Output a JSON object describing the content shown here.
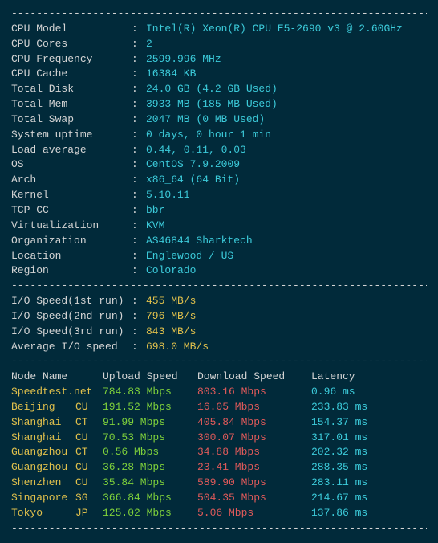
{
  "dash": "----------------------------------------------------------------------",
  "sys": [
    {
      "label": "CPU Model",
      "value": "Intel(R) Xeon(R) CPU E5-2690 v3 @ 2.60GHz",
      "class": "cyan"
    },
    {
      "label": "CPU Cores",
      "value": "2",
      "class": "cyan"
    },
    {
      "label": "CPU Frequency",
      "value": "2599.996 MHz",
      "class": "cyan"
    },
    {
      "label": "CPU Cache",
      "value": "16384 KB",
      "class": "cyan"
    },
    {
      "label": "Total Disk",
      "value": "24.0 GB (4.2 GB Used)",
      "class": "cyan"
    },
    {
      "label": "Total Mem",
      "value": "3933 MB (185 MB Used)",
      "class": "cyan"
    },
    {
      "label": "Total Swap",
      "value": "2047 MB (0 MB Used)",
      "class": "cyan"
    },
    {
      "label": "System uptime",
      "value": "0 days, 0 hour 1 min",
      "class": "cyan"
    },
    {
      "label": "Load average",
      "value": "0.44, 0.11, 0.03",
      "class": "cyan"
    },
    {
      "label": "OS",
      "value": "CentOS 7.9.2009",
      "class": "cyan"
    },
    {
      "label": "Arch",
      "value": "x86_64 (64 Bit)",
      "class": "cyan"
    },
    {
      "label": "Kernel",
      "value": "5.10.11",
      "class": "cyan"
    },
    {
      "label": "TCP CC",
      "value": "bbr",
      "class": "cyan"
    },
    {
      "label": "Virtualization",
      "value": "KVM",
      "class": "cyan"
    },
    {
      "label": "Organization",
      "value": "AS46844 Sharktech",
      "class": "cyan"
    },
    {
      "label": "Location",
      "value": "Englewood / US",
      "class": "cyan"
    },
    {
      "label": "Region",
      "value": "Colorado",
      "class": "cyan"
    }
  ],
  "io": [
    {
      "label": "I/O Speed(1st run)",
      "value": "455 MB/s",
      "class": "yellow"
    },
    {
      "label": "I/O Speed(2nd run)",
      "value": "796 MB/s",
      "class": "yellow"
    },
    {
      "label": "I/O Speed(3rd run)",
      "value": "843 MB/s",
      "class": "yellow"
    },
    {
      "label": "Average I/O speed",
      "value": "698.0 MB/s",
      "class": "yellow"
    }
  ],
  "st_header": {
    "node": "Node Name",
    "upload": "Upload Speed",
    "download": "Download Speed",
    "latency": "Latency"
  },
  "st": [
    {
      "node": "Speedtest.net",
      "loc": "",
      "up": "784.83 Mbps",
      "down": "803.16 Mbps",
      "lat": "0.96 ms"
    },
    {
      "node": "Beijing",
      "loc": "CU",
      "up": "191.52 Mbps",
      "down": "16.05 Mbps",
      "lat": "233.83 ms"
    },
    {
      "node": "Shanghai",
      "loc": "CT",
      "up": "91.99 Mbps",
      "down": "405.84 Mbps",
      "lat": "154.37 ms"
    },
    {
      "node": "Shanghai",
      "loc": "CU",
      "up": "70.53 Mbps",
      "down": "300.07 Mbps",
      "lat": "317.01 ms"
    },
    {
      "node": "Guangzhou",
      "loc": "CT",
      "up": "0.56 Mbps",
      "down": "34.88 Mbps",
      "lat": "202.32 ms"
    },
    {
      "node": "Guangzhou",
      "loc": "CU",
      "up": "36.28 Mbps",
      "down": "23.41 Mbps",
      "lat": "288.35 ms"
    },
    {
      "node": "Shenzhen",
      "loc": "CU",
      "up": "35.84 Mbps",
      "down": "589.90 Mbps",
      "lat": "283.11 ms"
    },
    {
      "node": "Singapore",
      "loc": "SG",
      "up": "366.84 Mbps",
      "down": "504.35 Mbps",
      "lat": "214.67 ms"
    },
    {
      "node": "Tokyo",
      "loc": "JP",
      "up": "125.02 Mbps",
      "down": "5.06 Mbps",
      "lat": "137.86 ms"
    }
  ]
}
